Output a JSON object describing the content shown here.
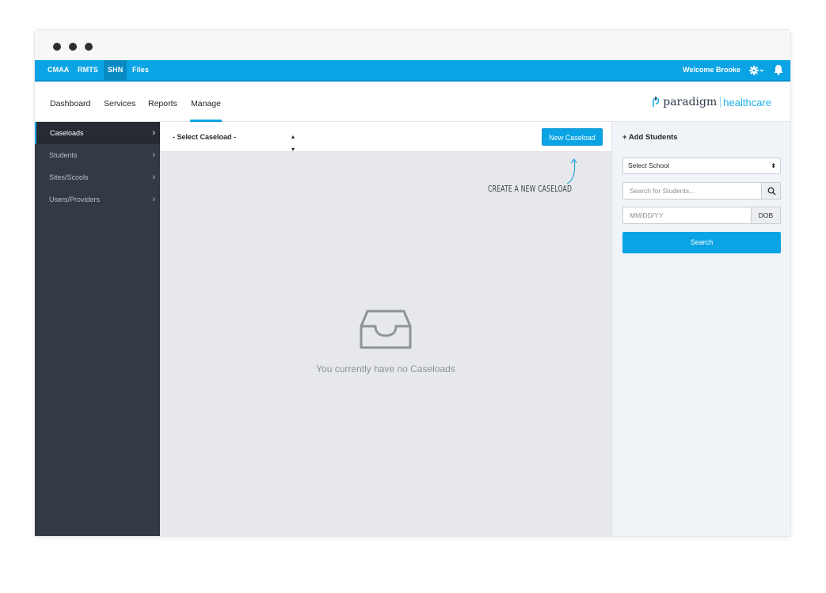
{
  "window": {
    "controls": [
      "dot",
      "dot",
      "dot"
    ]
  },
  "topbar": {
    "links": [
      {
        "label": "CMAA",
        "active": false
      },
      {
        "label": "RMTS",
        "active": false
      },
      {
        "label": "SHN",
        "active": true
      },
      {
        "label": "Files",
        "active": false
      }
    ],
    "welcome": "Welcome Brooke",
    "settings_icon": "gear-icon",
    "notifications_icon": "bell-icon"
  },
  "navbar": {
    "items": [
      {
        "label": "Dashboard",
        "active": false
      },
      {
        "label": "Services",
        "active": false
      },
      {
        "label": "Reports",
        "active": false
      },
      {
        "label": "Manage",
        "active": true
      }
    ],
    "logo": {
      "main": "paradigm",
      "sub": "healthcare"
    }
  },
  "sidebar": {
    "items": [
      {
        "label": "Caseloads",
        "active": true
      },
      {
        "label": "Students",
        "active": false
      },
      {
        "label": "Sites/Scools",
        "active": false
      },
      {
        "label": "Users/Providers",
        "active": false
      }
    ],
    "chevron": "›"
  },
  "main": {
    "caseload_select": "- Select Caseload -",
    "new_caseload_button": "New Caseload",
    "hint": "CREATE A NEW CASELOAD",
    "empty_icon": "inbox-tray-icon",
    "empty_message": "You currently have no Caseloads"
  },
  "right_panel": {
    "title": "+ Add Students",
    "school_select": "Select School",
    "search_placeholder": "Search for Students...",
    "dob_placeholder": "MM/DD/YY",
    "dob_label": "DOB",
    "search_button": "Search"
  },
  "colors": {
    "accent": "#0aa4e5",
    "sidebar_bg": "#333a45",
    "main_bg": "#e6e8ec"
  }
}
